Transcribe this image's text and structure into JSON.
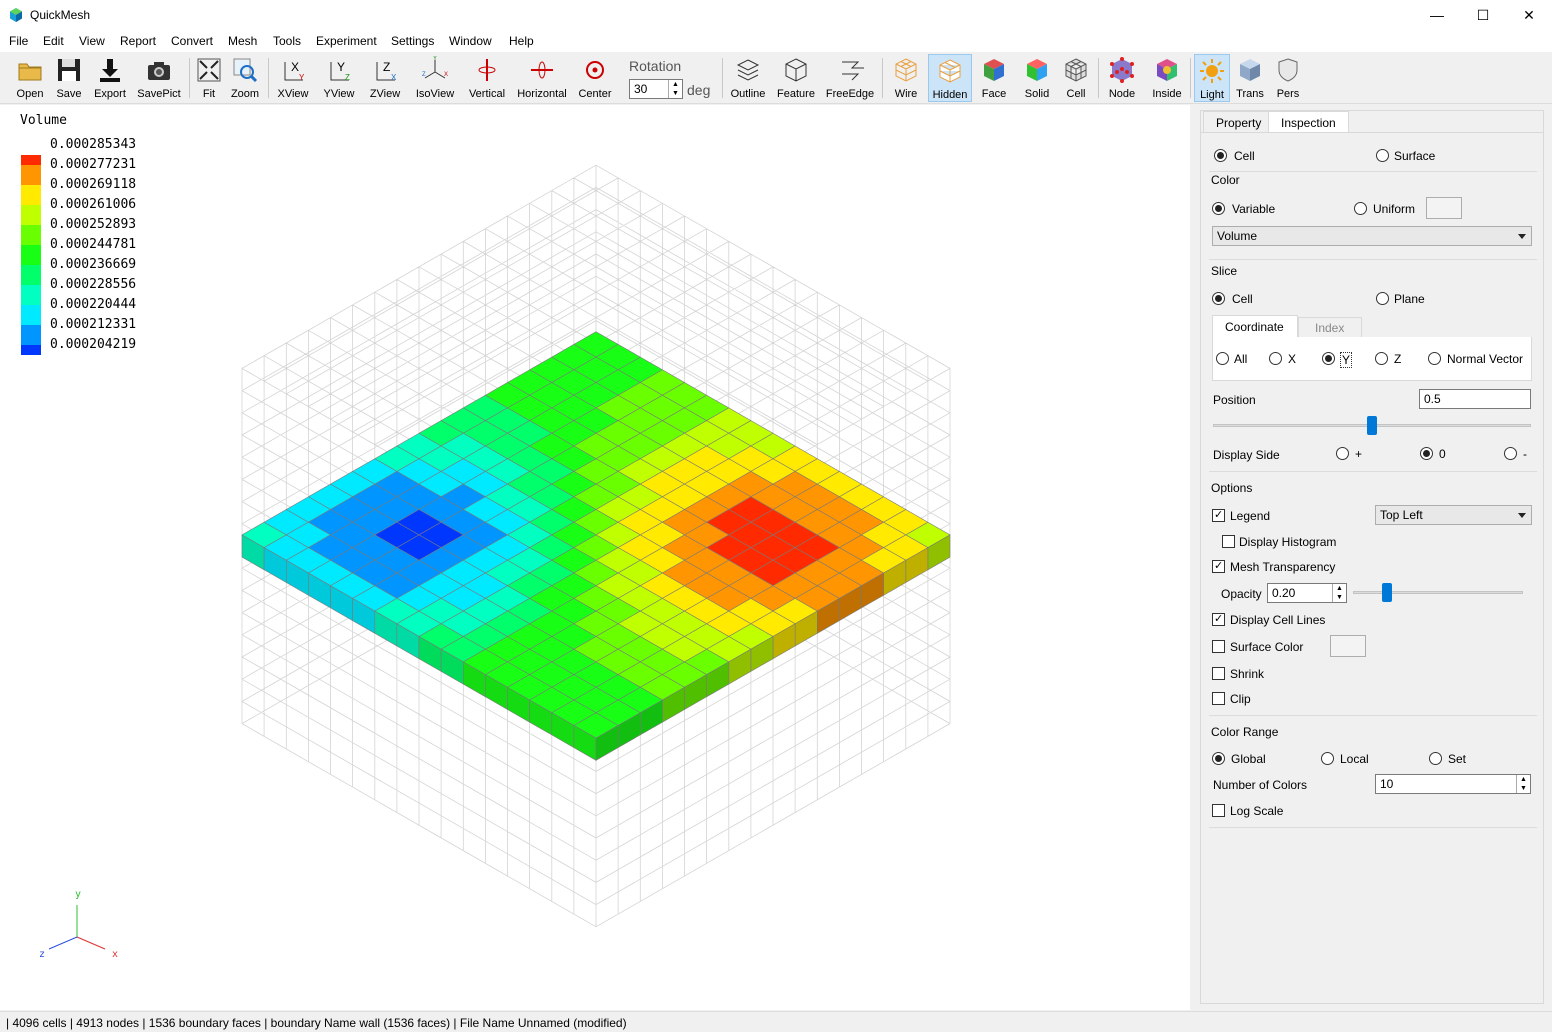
{
  "app": {
    "title": "QuickMesh",
    "minimize": "—",
    "maximize": "☐",
    "close": "✕"
  },
  "menu": [
    "File",
    "Edit",
    "View",
    "Report",
    "Convert",
    "Mesh",
    "Tools",
    "Experiment",
    "Settings",
    "Window",
    "Help"
  ],
  "toolbar": {
    "open": "Open",
    "save": "Save",
    "export": "Export",
    "savepict": "SavePict",
    "fit": "Fit",
    "zoom": "Zoom",
    "xview": "XView",
    "yview": "YView",
    "zview": "ZView",
    "isoview": "IsoView",
    "vertical": "Vertical",
    "horizontal": "Horizontal",
    "center": "Center",
    "rotation_label": "Rotation",
    "rotation_value": "30",
    "rotation_unit": "deg",
    "outline": "Outline",
    "feature": "Feature",
    "freeedge": "FreeEdge",
    "wire": "Wire",
    "hidden": "Hidden",
    "face": "Face",
    "solid": "Solid",
    "cell": "Cell",
    "node": "Node",
    "inside": "Inside",
    "light": "Light",
    "trans": "Trans",
    "pers": "Pers"
  },
  "legend": {
    "title": "Volume",
    "entries": [
      {
        "value": "0.000285343",
        "color": "#ff2a00"
      },
      {
        "value": "0.000277231",
        "color": "#ff9500"
      },
      {
        "value": "0.000269118",
        "color": "#ffea00"
      },
      {
        "value": "0.000261006",
        "color": "#c0ff00"
      },
      {
        "value": "0.000252893",
        "color": "#6aff00"
      },
      {
        "value": "0.000244781",
        "color": "#18ff15"
      },
      {
        "value": "0.000236669",
        "color": "#00ff6a"
      },
      {
        "value": "0.000228556",
        "color": "#00ffc0"
      },
      {
        "value": "0.000220444",
        "color": "#00eaff"
      },
      {
        "value": "0.000212331",
        "color": "#0095ff"
      },
      {
        "value": "0.000204219",
        "color": "#0037ff"
      }
    ]
  },
  "axes": {
    "x": "x",
    "y": "y",
    "z": "z"
  },
  "panel": {
    "tabs": [
      "Property",
      "Inspection"
    ],
    "active_tab": "Inspection",
    "target": {
      "cell": "Cell",
      "surface": "Surface",
      "selected": "Cell"
    },
    "color": {
      "group": "Color",
      "variable": "Variable",
      "uniform": "Uniform",
      "selected": "Variable",
      "variable_value": "Volume"
    },
    "slice": {
      "group": "Slice",
      "cell": "Cell",
      "plane": "Plane",
      "selected": "Cell",
      "subtabs": [
        "Coordinate",
        "Index"
      ],
      "axes": [
        "All",
        "X",
        "Y",
        "Z",
        "Normal Vector"
      ],
      "axis_selected": "Y",
      "position_label": "Position",
      "position_value": "0.5",
      "position_fraction": 0.5,
      "display_side_label": "Display Side",
      "sides": [
        "+",
        "0",
        "-"
      ],
      "side_selected": "0"
    },
    "options": {
      "group": "Options",
      "legend": "Legend",
      "legend_checked": true,
      "legend_position": "Top Left",
      "display_histogram": "Display Histogram",
      "display_histogram_checked": false,
      "mesh_transparency": "Mesh Transparency",
      "mesh_transparency_checked": true,
      "opacity_label": "Opacity",
      "opacity_value": "0.20",
      "opacity_fraction": 0.2,
      "display_cell_lines": "Display Cell Lines",
      "display_cell_lines_checked": true,
      "surface_color": "Surface Color",
      "surface_color_checked": false,
      "shrink": "Shrink",
      "shrink_checked": false,
      "clip": "Clip",
      "clip_checked": false
    },
    "color_range": {
      "group": "Color Range",
      "global": "Global",
      "local": "Local",
      "set": "Set",
      "selected": "Global",
      "num_colors_label": "Number of Colors",
      "num_colors_value": "10",
      "log_scale": "Log Scale",
      "log_scale_checked": false
    }
  },
  "status": " | 4096 cells | 4913 nodes | 1536 boundary faces |  boundary Name wall (1536 faces) | File Name Unnamed (modified)"
}
